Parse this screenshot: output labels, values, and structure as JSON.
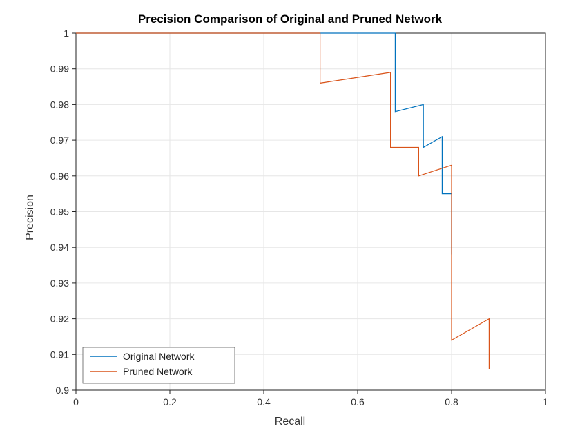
{
  "chart_data": {
    "type": "line",
    "title": "Precision Comparison of Original and Pruned Network",
    "xlabel": "Recall",
    "ylabel": "Precision",
    "xlim": [
      0,
      1
    ],
    "ylim": [
      0.9,
      1
    ],
    "xticks": [
      0,
      0.2,
      0.4,
      0.6,
      0.8,
      1
    ],
    "yticks": [
      0.9,
      0.91,
      0.92,
      0.93,
      0.94,
      0.95,
      0.96,
      0.97,
      0.98,
      0.99,
      1
    ],
    "legend_position": "lower-left",
    "series": [
      {
        "name": "Original Network",
        "color": "#0072BD",
        "x": [
          0.0,
          0.68,
          0.68,
          0.74,
          0.74,
          0.78,
          0.78,
          0.8,
          0.8
        ],
        "y": [
          1.0,
          1.0,
          0.978,
          0.98,
          0.968,
          0.971,
          0.955,
          0.955,
          0.938
        ]
      },
      {
        "name": "Pruned Network",
        "color": "#D95319",
        "x": [
          0.0,
          0.52,
          0.52,
          0.67,
          0.67,
          0.73,
          0.73,
          0.8,
          0.8,
          0.8,
          0.8,
          0.88,
          0.88
        ],
        "y": [
          1.0,
          1.0,
          0.986,
          0.989,
          0.968,
          0.968,
          0.96,
          0.963,
          0.922,
          0.922,
          0.914,
          0.92,
          0.906
        ]
      }
    ]
  },
  "colors": {
    "axis": "#222222",
    "grid": "#e6e6e6",
    "series1": "#0072BD",
    "series2": "#D95319"
  }
}
